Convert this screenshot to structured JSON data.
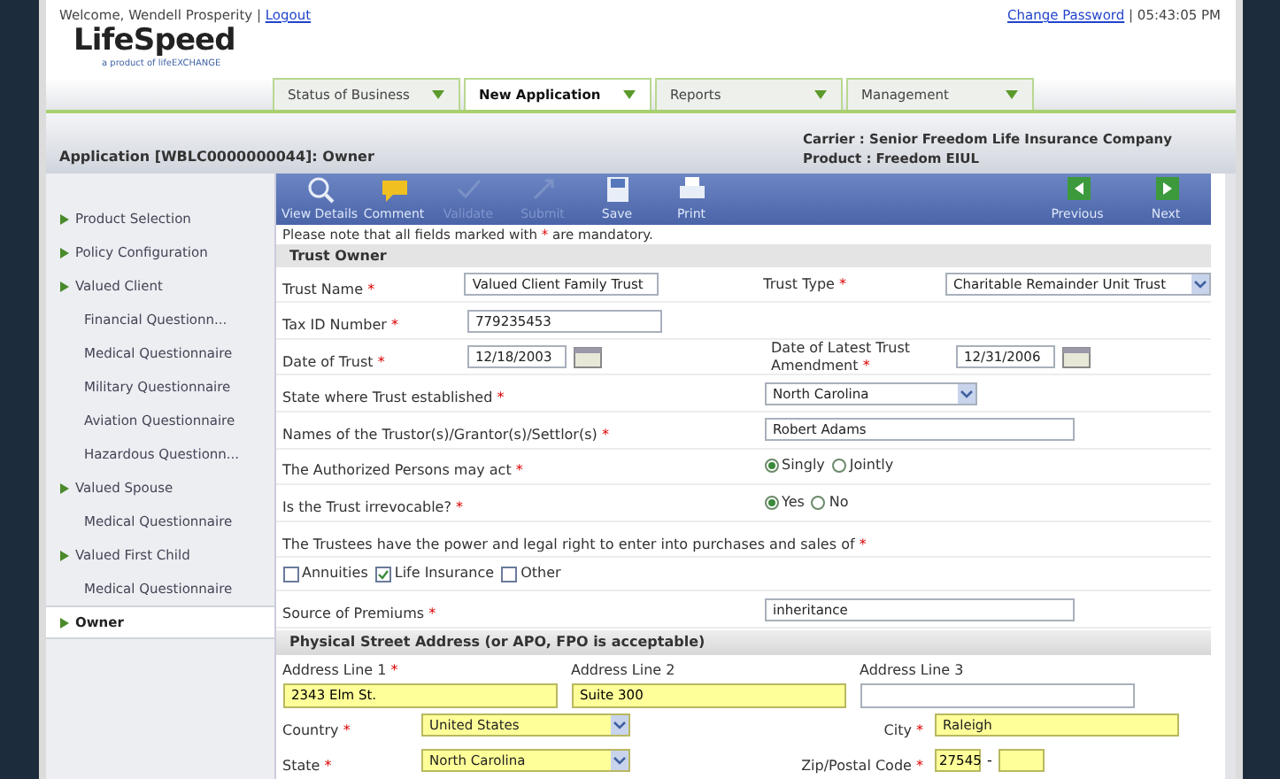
{
  "header": {
    "welcome": "Welcome, Wendell Prosperity |",
    "logout": "Logout",
    "change_password": "Change Password",
    "time": "| 05:43:05 PM",
    "logo": "LifeSpeed",
    "tagline": "a product of lifeEXCHANGE"
  },
  "tabs": [
    {
      "label": "Status of Business",
      "selected": false
    },
    {
      "label": "New Application",
      "selected": true
    },
    {
      "label": "Reports",
      "selected": false
    },
    {
      "label": "Management",
      "selected": false
    }
  ],
  "title_bar": {
    "application": "Application [WBLC0000000044]: Owner",
    "carrier": "Carrier : Senior Freedom Life Insurance Company",
    "product": "Product : Freedom EIUL"
  },
  "sidebar": {
    "items": [
      {
        "label": "Product Selection",
        "selected": false
      },
      {
        "label": "Policy Configuration",
        "selected": false
      },
      {
        "label": "Valued Client",
        "selected": false,
        "children": [
          {
            "label": "Financial Questionn...",
            "selected": false
          },
          {
            "label": "Medical Questionnaire",
            "selected": false
          },
          {
            "label": "Military Questionnaire",
            "selected": false
          },
          {
            "label": "Aviation Questionnaire",
            "selected": false
          },
          {
            "label": "Hazardous Questionn...",
            "selected": false
          }
        ]
      },
      {
        "label": "Valued Spouse",
        "selected": false,
        "children": [
          {
            "label": "Medical Questionnaire",
            "selected": false
          }
        ]
      },
      {
        "label": "Valued First Child",
        "selected": false,
        "children": [
          {
            "label": "Medical Questionnaire",
            "selected": false
          }
        ]
      },
      {
        "label": "Owner",
        "selected": true
      }
    ]
  },
  "toolbar": {
    "left": [
      {
        "kind": "search",
        "label": "View Details",
        "disabled": false
      },
      {
        "kind": "comment",
        "label": "Comment",
        "disabled": false
      },
      {
        "kind": "check",
        "label": "Validate",
        "disabled": true
      },
      {
        "kind": "submit",
        "label": "Submit",
        "disabled": true
      },
      {
        "kind": "save",
        "label": "Save",
        "disabled": false
      },
      {
        "kind": "print",
        "label": "Print",
        "disabled": false
      }
    ],
    "right": [
      {
        "kind": "prev",
        "label": "Previous",
        "disabled": false
      },
      {
        "kind": "next",
        "label": "Next",
        "disabled": false
      }
    ]
  },
  "notice": {
    "before": "Please note that all fields marked with",
    "mark": "*",
    "after": "are mandatory."
  },
  "trust_owner": {
    "title": "Trust Owner",
    "rows": [
      {
        "kind": "pair",
        "left": {
          "label": "Trust Name",
          "mark": "*",
          "kind": "text",
          "value": "Valued Client Family Trust"
        },
        "right": {
          "label": "Trust Type",
          "mark": "*",
          "kind": "select",
          "value": "Charitable Remainder Unit Trust"
        }
      },
      {
        "kind": "pair",
        "left": {
          "label": "Tax ID Number",
          "mark": "*",
          "kind": "text",
          "value": "779235453"
        }
      },
      {
        "kind": "pair",
        "left": {
          "label": "Date of Trust",
          "mark": "*",
          "kind": "date",
          "value": "12/18/2003"
        },
        "right": {
          "label": "Date of Latest Trust Amendment",
          "mark": "*",
          "kind": "date",
          "value": "12/31/2006"
        }
      },
      {
        "kind": "wide",
        "field": {
          "label": "State where Trust established",
          "mark": "*",
          "kind": "select",
          "value": "North Carolina"
        }
      },
      {
        "kind": "wide",
        "field": {
          "label": "Names of the Trustor(s)/Grantor(s)/Settlor(s)",
          "mark": "*",
          "kind": "text",
          "value": "Robert Adams"
        }
      },
      {
        "kind": "wide",
        "field": {
          "label": "The Authorized Persons may act",
          "mark": "*",
          "kind": "radio",
          "options": [
            {
              "label": "Singly",
              "selected": true
            },
            {
              "label": "Jointly",
              "selected": false
            }
          ]
        }
      },
      {
        "kind": "wide",
        "field": {
          "label": "Is the Trust irrevocable?",
          "mark": "*",
          "kind": "radio",
          "options": [
            {
              "label": "Yes",
              "selected": true
            },
            {
              "label": "No",
              "selected": false
            }
          ]
        }
      },
      {
        "kind": "note",
        "field": {
          "label": "The Trustees have the power and legal right to enter into purchases and sales of",
          "mark": "*"
        }
      },
      {
        "kind": "checks",
        "options": [
          {
            "label": "Annuities",
            "checked": false
          },
          {
            "label": "Life Insurance",
            "checked": true
          },
          {
            "label": "Other",
            "checked": false
          }
        ]
      },
      {
        "kind": "wide",
        "field": {
          "label": "Source of Premiums",
          "mark": "*",
          "kind": "text",
          "value": "inheritance"
        }
      }
    ]
  },
  "address": {
    "title": "Physical Street Address (or APO, FPO is acceptable)",
    "lines": [
      {
        "label": "Address Line 1",
        "mark": "*",
        "value": "2343 Elm St.",
        "highlighted": true
      },
      {
        "label": "Address Line 2",
        "value": "Suite 300",
        "highlighted": true
      },
      {
        "label": "Address Line 3",
        "highlighted": false
      }
    ],
    "rows": [
      {
        "left": {
          "label": "Country",
          "mark": "*",
          "kind": "select",
          "value": "United States",
          "highlighted": true
        },
        "right": {
          "label": "City",
          "mark": "*",
          "kind": "text",
          "value": "Raleigh",
          "highlighted": true
        }
      },
      {
        "left": {
          "label": "State",
          "mark": "*",
          "kind": "select",
          "value": "North Carolina",
          "highlighted": true
        },
        "right": {
          "label": "Zip/Postal Code",
          "mark": "*",
          "kind": "zip",
          "value": "27545",
          "separator": "-",
          "highlighted": true
        }
      }
    ]
  }
}
